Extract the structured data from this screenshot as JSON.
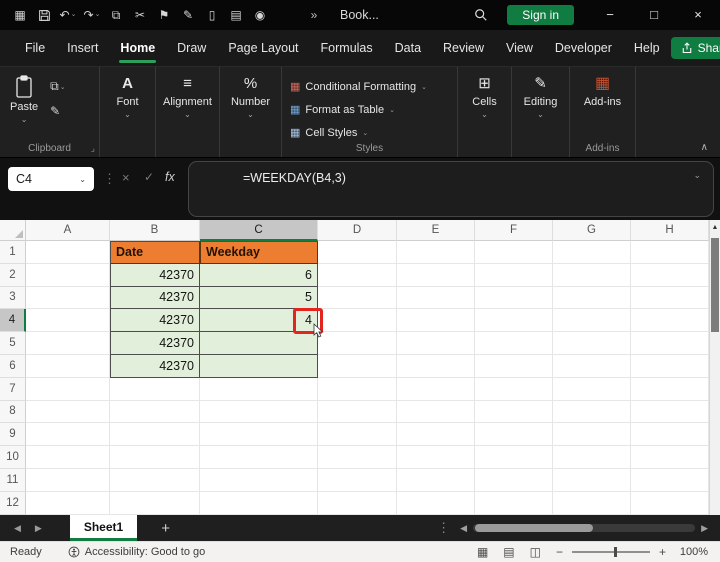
{
  "titlebar": {
    "workbook_name": "Book...",
    "sign_in": "Sign in"
  },
  "menu": {
    "items": [
      "File",
      "Insert",
      "Home",
      "Draw",
      "Page Layout",
      "Formulas",
      "Data",
      "Review",
      "View",
      "Developer",
      "Help"
    ],
    "active": "Home",
    "share": "Share"
  },
  "ribbon": {
    "paste": "Paste",
    "groups": {
      "clipboard": "Clipboard",
      "styles": "Styles",
      "addins": "Add-ins"
    },
    "buttons": {
      "font": "Font",
      "alignment": "Alignment",
      "number": "Number",
      "conditional_formatting": "Conditional Formatting",
      "format_as_table": "Format as Table",
      "cell_styles": "Cell Styles",
      "cells": "Cells",
      "editing": "Editing",
      "addins": "Add-ins"
    }
  },
  "formula_bar": {
    "name_box": "C4",
    "fx": "fx",
    "formula": "=WEEKDAY(B4,3)"
  },
  "grid": {
    "columns": [
      "A",
      "B",
      "C",
      "D",
      "E",
      "F",
      "G",
      "H"
    ],
    "rows": [
      "1",
      "2",
      "3",
      "4",
      "5",
      "6",
      "7",
      "8",
      "9",
      "10",
      "11",
      "12"
    ],
    "active_column": "C",
    "active_row": "4",
    "active_cell": "C4",
    "cells": [
      {
        "ref": "B1",
        "text": "Date",
        "style": "hdr"
      },
      {
        "ref": "C1",
        "text": "Weekday",
        "style": "hdr"
      },
      {
        "ref": "B2",
        "text": "42370",
        "style": "num"
      },
      {
        "ref": "C2",
        "text": "6",
        "style": "num"
      },
      {
        "ref": "B3",
        "text": "42370",
        "style": "num"
      },
      {
        "ref": "C3",
        "text": "5",
        "style": "num"
      },
      {
        "ref": "B4",
        "text": "42370",
        "style": "num"
      },
      {
        "ref": "C4",
        "text": "4",
        "style": "num"
      },
      {
        "ref": "B5",
        "text": "42370",
        "style": "num"
      },
      {
        "ref": "C5",
        "text": "",
        "style": "num"
      },
      {
        "ref": "B6",
        "text": "42370",
        "style": "num"
      },
      {
        "ref": "C6",
        "text": "",
        "style": "num"
      }
    ]
  },
  "sheetbar": {
    "tabs": [
      "Sheet1"
    ],
    "active": "Sheet1"
  },
  "statusbar": {
    "ready": "Ready",
    "accessibility": "Accessibility: Good to go",
    "zoom": "100%"
  },
  "icons": {
    "app_menu": "▦",
    "undo": "↶",
    "redo": "↷",
    "chevron": "⌄",
    "copy": "⧉",
    "cut": "✂",
    "flag": "⚑",
    "brush": "✎",
    "doc": "▯",
    "print": "▤",
    "camera": "◉",
    "overflow": "»",
    "minimize": "−",
    "maximize": "□",
    "close": "×",
    "dots": "⋮",
    "cancel": "×",
    "check": "✓",
    "font": "A",
    "alignment": "≡",
    "number": "%",
    "cf": "▦",
    "table": "▦",
    "cellstyles": "▦",
    "cells": "⊞",
    "editing": "✎",
    "addins": "▦",
    "launcher": "⌟",
    "collapse": "∧",
    "up": "▲",
    "left": "◀",
    "right": "▶",
    "plus": "+",
    "minus": "−",
    "view_normal": "▦",
    "view_layout": "▤",
    "view_break": "◫"
  },
  "colors": {
    "header_fill": "#ED7D31",
    "data_fill": "#E2EFDA",
    "accent_green": "#107C41",
    "annotation_red": "#E3241F"
  }
}
